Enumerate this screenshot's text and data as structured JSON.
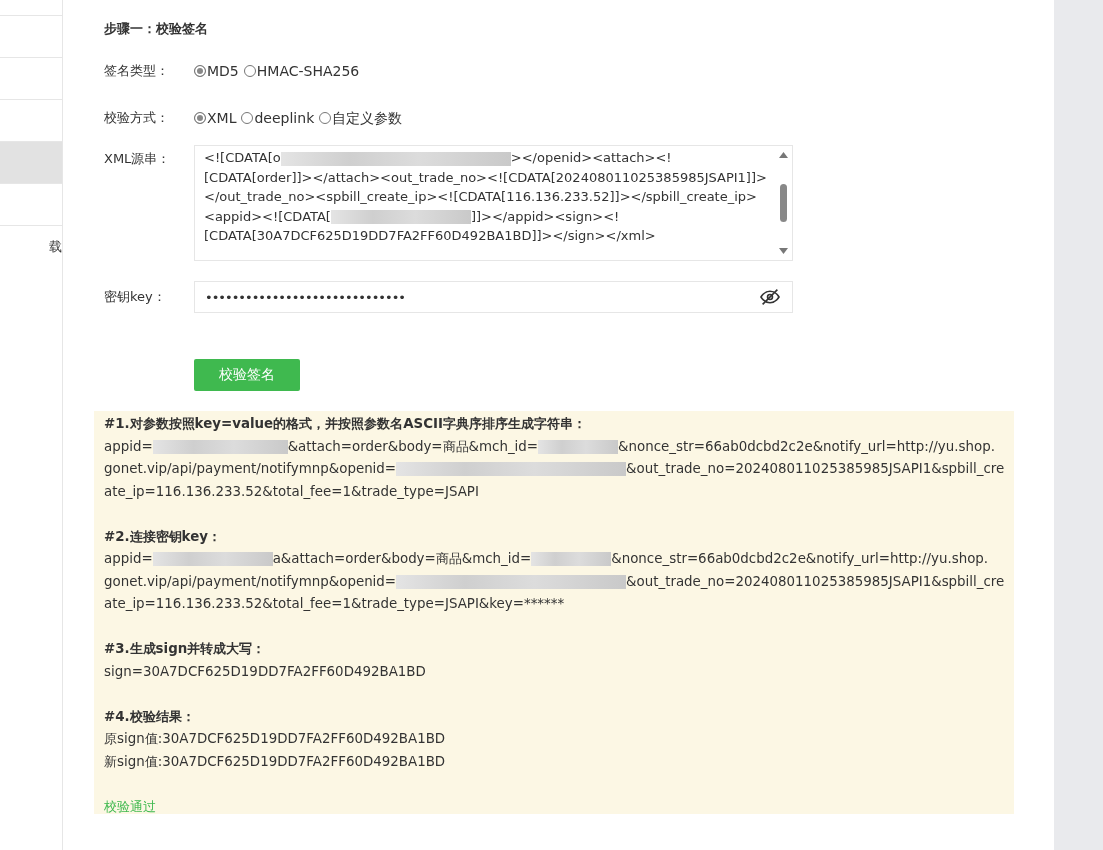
{
  "sidebar": {
    "items": [
      {
        "selected": false
      },
      {
        "selected": false
      },
      {
        "selected": false
      },
      {
        "selected": true
      },
      {
        "selected": false
      },
      {
        "selected": false,
        "label": "载"
      }
    ]
  },
  "step_title": "步骤一：校验签名",
  "sign_type": {
    "label": "签名类型：",
    "options": [
      {
        "label": "MD5",
        "selected": true
      },
      {
        "label": "HMAC-SHA256",
        "selected": false
      }
    ]
  },
  "verify_method": {
    "label": "校验方式：",
    "options": [
      {
        "label": "XML",
        "selected": true
      },
      {
        "label": "deeplink",
        "selected": false
      },
      {
        "label": "自定义参数",
        "selected": false
      }
    ]
  },
  "xml_source": {
    "label": "XML源串：",
    "lines": [
      [
        {
          "kind": "text",
          "text": "<![CDATA[o"
        },
        {
          "kind": "blur"
        },
        {
          "kind": "text",
          "text": "></openid><attach><!"
        }
      ],
      [
        {
          "kind": "text",
          "text": "[CDATA[order]]></attach><out_trade_no><![CDATA[202408011025385985JSAPI1]]>"
        }
      ],
      [
        {
          "kind": "text",
          "text": "</out_trade_no><spbill_create_ip><![CDATA[116.136.233.52]]></spbill_create_ip>"
        }
      ],
      [
        {
          "kind": "text",
          "text": "<appid><![CDATA["
        },
        {
          "kind": "blur"
        },
        {
          "kind": "text",
          "text": "]]></appid><sign><!"
        }
      ],
      [
        {
          "kind": "text",
          "text": "[CDATA[30A7DCF625D19DD7FA2FF60D492BA1BD]]></sign></xml>"
        }
      ]
    ]
  },
  "secret_key": {
    "label": "密钥key：",
    "value": "••••••••••••••••••••••••••••••"
  },
  "verify_button": "校验签名",
  "result": {
    "sections": [
      {
        "heading": "#1.对参数按照key=value的格式，并按照参数名ASCII字典序排序生成字符串：",
        "lines": [
          [
            {
              "kind": "text",
              "text": "appid="
            },
            {
              "kind": "blur"
            },
            {
              "kind": "text",
              "text": "&attach=order&body=商品&mch_id="
            },
            {
              "kind": "blur"
            },
            {
              "kind": "text",
              "text": "&nonce_str=66ab0dcbd2c2e&notify_url=http://yu.shop."
            }
          ],
          [
            {
              "kind": "text",
              "text": "gonet.vip/api/payment/notifymnp&openid="
            },
            {
              "kind": "blur"
            },
            {
              "kind": "text",
              "text": "&out_trade_no=202408011025385985JSAPI1&spbill_cre"
            }
          ],
          [
            {
              "kind": "text",
              "text": "ate_ip=116.136.233.52&total_fee=1&trade_type=JSAPI"
            }
          ]
        ]
      },
      {
        "heading": "#2.连接密钥key：",
        "lines": [
          [
            {
              "kind": "text",
              "text": "appid="
            },
            {
              "kind": "blur"
            },
            {
              "kind": "text",
              "text": "a&attach=order&body=商品&mch_id="
            },
            {
              "kind": "blur"
            },
            {
              "kind": "text",
              "text": "&nonce_str=66ab0dcbd2c2e&notify_url=http://yu.shop."
            }
          ],
          [
            {
              "kind": "text",
              "text": "gonet.vip/api/payment/notifymnp&openid="
            },
            {
              "kind": "blur"
            },
            {
              "kind": "text",
              "text": "&out_trade_no=202408011025385985JSAPI1&spbill_cre"
            }
          ],
          [
            {
              "kind": "text",
              "text": "ate_ip=116.136.233.52&total_fee=1&trade_type=JSAPI&key=******"
            }
          ]
        ]
      },
      {
        "heading": "#3.生成sign并转成大写：",
        "lines": [
          [
            {
              "kind": "text",
              "text": "sign=30A7DCF625D19DD7FA2FF60D492BA1BD"
            }
          ]
        ]
      },
      {
        "heading": "#4.校验结果：",
        "lines": [
          [
            {
              "kind": "text",
              "text": "原sign值:30A7DCF625D19DD7FA2FF60D492BA1BD"
            }
          ],
          [
            {
              "kind": "text",
              "text": "新sign值:30A7DCF625D19DD7FA2FF60D492BA1BD"
            }
          ]
        ]
      }
    ],
    "status": "校验通过"
  }
}
